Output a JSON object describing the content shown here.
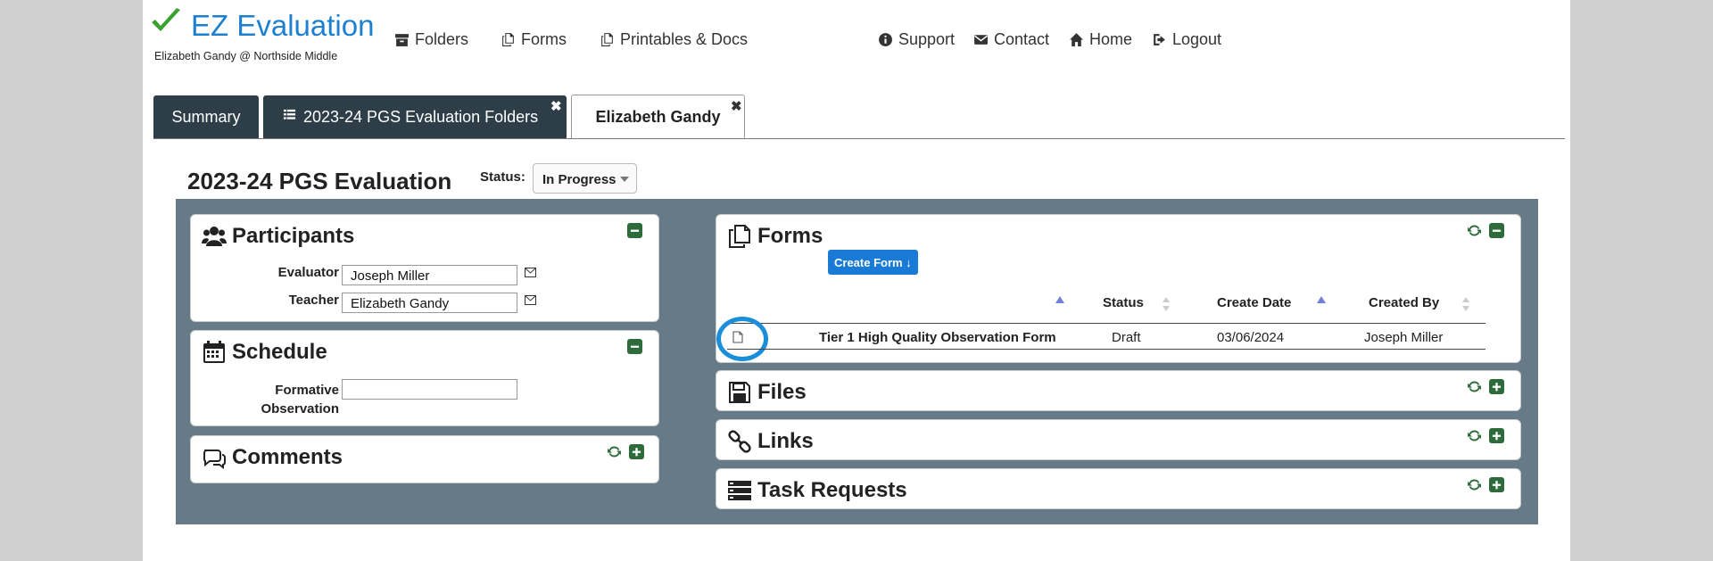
{
  "header": {
    "app_title": "EZ Evaluation",
    "user_line": "Elizabeth Gandy @ Northside Middle",
    "nav": [
      {
        "label": "Folders",
        "icon": "archive-icon"
      },
      {
        "label": "Forms",
        "icon": "copy-icon"
      },
      {
        "label": "Printables & Docs",
        "icon": "copy-icon"
      }
    ],
    "right_nav": [
      {
        "label": "Support",
        "icon": "info-circle-icon"
      },
      {
        "label": "Contact",
        "icon": "envelope-icon"
      },
      {
        "label": "Home",
        "icon": "home-icon"
      },
      {
        "label": "Logout",
        "icon": "sign-out-icon"
      }
    ]
  },
  "tabs": [
    {
      "label": "Summary"
    },
    {
      "label": "2023-24 PGS Evaluation Folders",
      "close": "✖"
    },
    {
      "label": "Elizabeth Gandy",
      "close": "✖"
    }
  ],
  "evaluation": {
    "title": "2023-24 PGS Evaluation",
    "status_label": "Status:",
    "status_value": "In Progress"
  },
  "participants": {
    "title": "Participants",
    "evaluator_label": "Evaluator",
    "evaluator_value": "Joseph Miller",
    "teacher_label": "Teacher",
    "teacher_value": "Elizabeth Gandy"
  },
  "schedule": {
    "title": "Schedule",
    "formative_label_1": "Formative",
    "formative_label_2": "Observation",
    "formative_value": ""
  },
  "comments": {
    "title": "Comments"
  },
  "forms": {
    "title": "Forms",
    "create_button": "Create Form ↓",
    "columns": [
      "Status",
      "Create Date",
      "Created By"
    ],
    "rows": [
      {
        "name": "Tier 1 High Quality Observation Form",
        "status": "Draft",
        "create_date": "03/06/2024",
        "created_by": "Joseph Miller"
      }
    ]
  },
  "files": {
    "title": "Files"
  },
  "links": {
    "title": "Links"
  },
  "task_requests": {
    "title": "Task Requests"
  },
  "colors": {
    "brand_blue": "#1c7fd0",
    "tab_dark": "#2e3e48",
    "panel_bg": "#667b87",
    "control_green": "#2e6b3a",
    "button_blue": "#1a7bd6",
    "highlight_ring": "#1a8ed8"
  }
}
